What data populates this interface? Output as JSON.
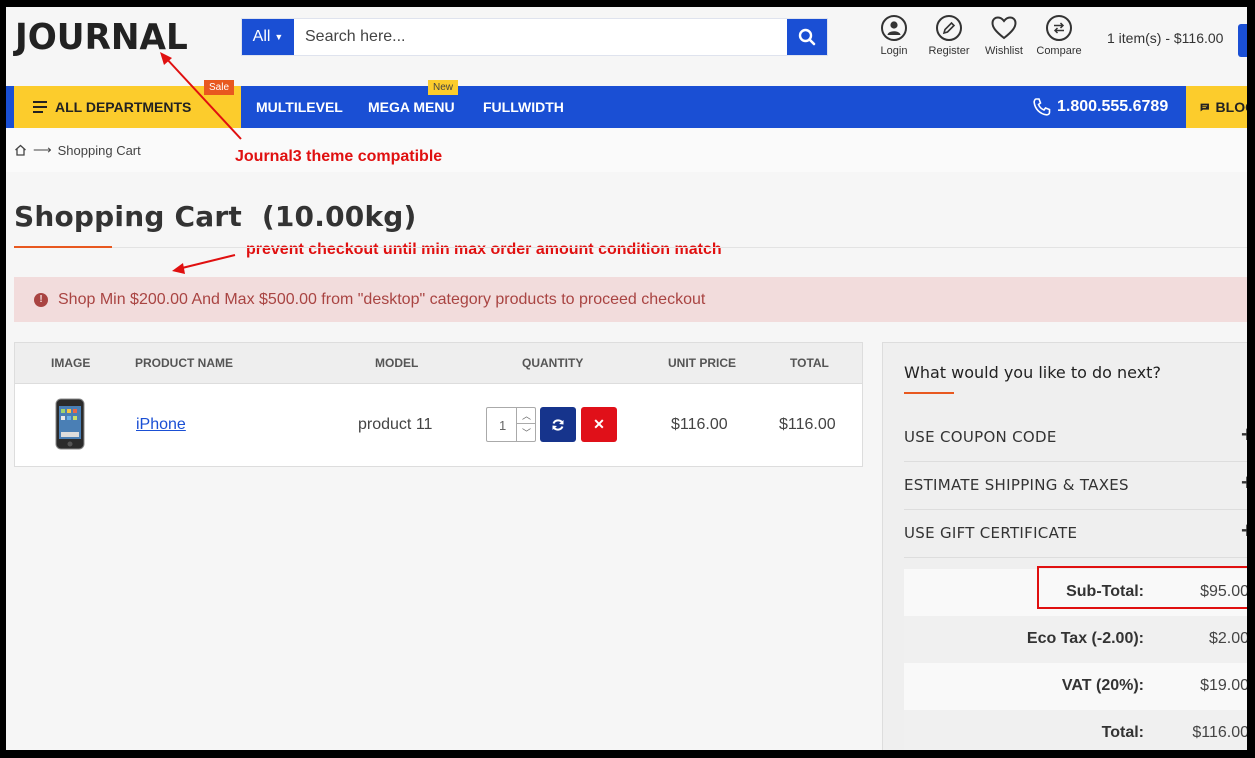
{
  "brand": {
    "logo": "JOURNAL"
  },
  "search": {
    "category": "All",
    "placeholder": "Search here..."
  },
  "header_links": [
    {
      "label": "Login",
      "icon": "user-icon"
    },
    {
      "label": "Register",
      "icon": "pencil-icon"
    },
    {
      "label": "Wishlist",
      "icon": "heart-icon"
    },
    {
      "label": "Compare",
      "icon": "compare-icon"
    }
  ],
  "cart_summary": "1 item(s) - $116.00",
  "nav": {
    "all_departments": "ALL DEPARTMENTS",
    "sale_badge": "Sale",
    "new_badge": "New",
    "links": [
      "MULTILEVEL",
      "MEGA MENU",
      "FULLWIDTH"
    ],
    "phone": "1.800.555.6789",
    "blog": "BLOG"
  },
  "breadcrumb": {
    "current": "Shopping Cart"
  },
  "annotations": {
    "theme": "Journal3 theme compatible",
    "checkout": "prevent checkout until min max order amount condition match"
  },
  "page": {
    "title": "Shopping Cart  (10.00kg)",
    "alert": "Shop Min $200.00 And Max $500.00 from \"desktop\" category products to proceed checkout"
  },
  "cart": {
    "headers": [
      "IMAGE",
      "PRODUCT NAME",
      "MODEL",
      "QUANTITY",
      "UNIT PRICE",
      "TOTAL"
    ],
    "rows": [
      {
        "name": "iPhone",
        "model": "product 11",
        "quantity": "1",
        "unit_price": "$116.00",
        "total": "$116.00"
      }
    ]
  },
  "next": {
    "title": "What would you like to do next?",
    "items": [
      "USE COUPON CODE",
      "ESTIMATE SHIPPING & TAXES",
      "USE GIFT CERTIFICATE"
    ]
  },
  "totals": [
    {
      "label": "Sub-Total:",
      "value": "$95.00"
    },
    {
      "label": "Eco Tax (-2.00):",
      "value": "$2.00"
    },
    {
      "label": "VAT (20%):",
      "value": "$19.00"
    },
    {
      "label": "Total:",
      "value": "$116.00"
    }
  ],
  "colors": {
    "primary": "#1a4fd4",
    "accent_yellow": "#fccc2c",
    "accent_orange": "#e8581f",
    "alert_bg": "#f2dcdc",
    "alert_text": "#a94442",
    "annotation": "#e01010"
  }
}
